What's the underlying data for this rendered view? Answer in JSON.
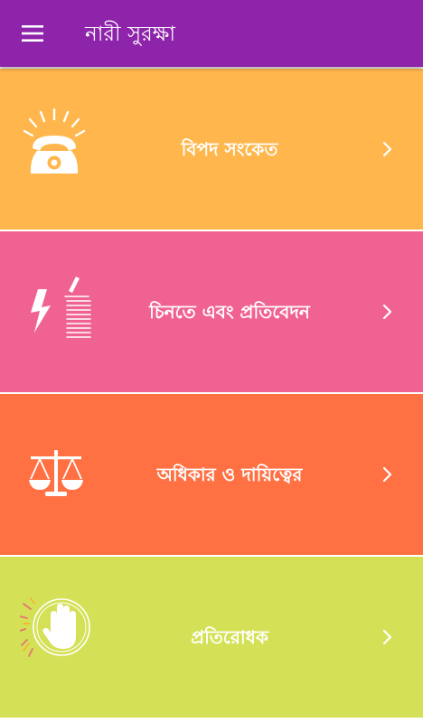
{
  "app_bar": {
    "title": "নারী সুরক্ষা",
    "menu_icon": "hamburger-menu-icon",
    "background": "#8E24AA"
  },
  "cards": [
    {
      "label": "বিপদ সংকেত",
      "icon": "telephone-ringing-icon",
      "color": "#FFB74D"
    },
    {
      "label": "চিনতে এবং প্রতিবেদন",
      "icon": "lightning-report-icon",
      "color": "#F06292"
    },
    {
      "label": "অধিকার ও দায়িত্বের",
      "icon": "balance-scale-icon",
      "color": "#FF7043"
    },
    {
      "label": "প্রতিরোধক",
      "icon": "stop-hand-icon",
      "color": "#D4E157"
    }
  ]
}
